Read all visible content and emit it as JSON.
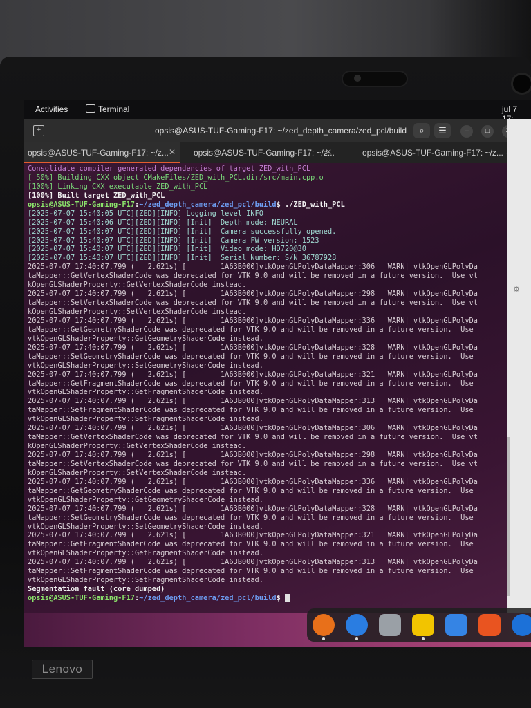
{
  "topbar": {
    "activities": "Activities",
    "app_name": "Terminal",
    "clock": "jul 7  17:"
  },
  "window": {
    "title": "opsis@ASUS-TUF-Gaming-F17: ~/zed_depth_camera/zed_pcl/build"
  },
  "tabs": [
    {
      "label": "opsis@ASUS-TUF-Gaming-F17: ~/z..."
    },
    {
      "label": "opsis@ASUS-TUF-Gaming-F17: ~/z..."
    },
    {
      "label": "opsis@ASUS-TUF-Gaming-F17: ~/z..."
    }
  ],
  "prompt": {
    "user": "opsis@ASUS-TUF-Gaming-F17",
    "path": "~/zed_depth_camera/zed_pcl/build"
  },
  "build": {
    "l0": "Consolidate compiler generated dependencies of target ZED_with_PCL",
    "l1": "[ 50%] Building CXX object CMakeFiles/ZED_with_PCL.dir/src/main.cpp.o",
    "l2": "[100%] Linking CXX executable ZED_with_PCL",
    "l3": "[100%] Built target ZED_with_PCL",
    "command": "$ ./ZED_with_PCL"
  },
  "zed_log": [
    "[2025-07-07 15:40:05 UTC][ZED][INFO] Logging level INFO",
    "[2025-07-07 15:40:06 UTC][ZED][INFO] [Init]  Depth mode: NEURAL",
    "[2025-07-07 15:40:07 UTC][ZED][INFO] [Init]  Camera successfully opened.",
    "[2025-07-07 15:40:07 UTC][ZED][INFO] [Init]  Camera FW version: 1523",
    "[2025-07-07 15:40:07 UTC][ZED][INFO] [Init]  Video mode: HD720@30",
    "[2025-07-07 15:40:07 UTC][ZED][INFO] [Init]  Serial Number: S/N 36787928"
  ],
  "vtk_warnings": [
    "2025-07-07 17:40:07.799 (   2.621s) [        1A63B000]vtkOpenGLPolyDataMapper:306   WARN| vtkOpenGLPolyDa",
    "taMapper::GetVertexShaderCode was deprecated for VTK 9.0 and will be removed in a future version.  Use vt",
    "kOpenGLShaderProperty::GetVertexShaderCode instead.",
    "2025-07-07 17:40:07.799 (   2.621s) [        1A63B000]vtkOpenGLPolyDataMapper:298   WARN| vtkOpenGLPolyDa",
    "taMapper::SetVertexShaderCode was deprecated for VTK 9.0 and will be removed in a future version.  Use vt",
    "kOpenGLShaderProperty::SetVertexShaderCode instead.",
    "2025-07-07 17:40:07.799 (   2.621s) [        1A63B000]vtkOpenGLPolyDataMapper:336   WARN| vtkOpenGLPolyDa",
    "taMapper::GetGeometryShaderCode was deprecated for VTK 9.0 and will be removed in a future version.  Use",
    "vtkOpenGLShaderProperty::GetGeometryShaderCode instead.",
    "2025-07-07 17:40:07.799 (   2.621s) [        1A63B000]vtkOpenGLPolyDataMapper:328   WARN| vtkOpenGLPolyDa",
    "taMapper::SetGeometryShaderCode was deprecated for VTK 9.0 and will be removed in a future version.  Use",
    "vtkOpenGLShaderProperty::SetGeometryShaderCode instead.",
    "2025-07-07 17:40:07.799 (   2.621s) [        1A63B000]vtkOpenGLPolyDataMapper:321   WARN| vtkOpenGLPolyDa",
    "taMapper::GetFragmentShaderCode was deprecated for VTK 9.0 and will be removed in a future version.  Use",
    "vtkOpenGLShaderProperty::GetFragmentShaderCode instead.",
    "2025-07-07 17:40:07.799 (   2.621s) [        1A63B000]vtkOpenGLPolyDataMapper:313   WARN| vtkOpenGLPolyDa",
    "taMapper::SetFragmentShaderCode was deprecated for VTK 9.0 and will be removed in a future version.  Use",
    "vtkOpenGLShaderProperty::SetFragmentShaderCode instead.",
    "2025-07-07 17:40:07.799 (   2.621s) [        1A63B000]vtkOpenGLPolyDataMapper:306   WARN| vtkOpenGLPolyDa",
    "taMapper::GetVertexShaderCode was deprecated for VTK 9.0 and will be removed in a future version.  Use vt",
    "kOpenGLShaderProperty::GetVertexShaderCode instead.",
    "2025-07-07 17:40:07.799 (   2.621s) [        1A63B000]vtkOpenGLPolyDataMapper:298   WARN| vtkOpenGLPolyDa",
    "taMapper::SetVertexShaderCode was deprecated for VTK 9.0 and will be removed in a future version.  Use vt",
    "kOpenGLShaderProperty::SetVertexShaderCode instead.",
    "2025-07-07 17:40:07.799 (   2.621s) [        1A63B000]vtkOpenGLPolyDataMapper:336   WARN| vtkOpenGLPolyDa",
    "taMapper::GetGeometryShaderCode was deprecated for VTK 9.0 and will be removed in a future version.  Use",
    "vtkOpenGLShaderProperty::GetGeometryShaderCode instead.",
    "2025-07-07 17:40:07.799 (   2.621s) [        1A63B000]vtkOpenGLPolyDataMapper:328   WARN| vtkOpenGLPolyDa",
    "taMapper::SetGeometryShaderCode was deprecated for VTK 9.0 and will be removed in a future version.  Use",
    "vtkOpenGLShaderProperty::SetGeometryShaderCode instead.",
    "2025-07-07 17:40:07.799 (   2.621s) [        1A63B000]vtkOpenGLPolyDataMapper:321   WARN| vtkOpenGLPolyDa",
    "taMapper::GetFragmentShaderCode was deprecated for VTK 9.0 and will be removed in a future version.  Use",
    "vtkOpenGLShaderProperty::GetFragmentShaderCode instead.",
    "2025-07-07 17:40:07.799 (   2.621s) [        1A63B000]vtkOpenGLPolyDataMapper:313   WARN| vtkOpenGLPolyDa",
    "taMapper::SetFragmentShaderCode was deprecated for VTK 9.0 and will be removed in a future version.  Use",
    "vtkOpenGLShaderProperty::SetFragmentShaderCode instead."
  ],
  "error_line": "Segmentation fault (core dumped)",
  "prompt_suffix": "$ ",
  "dock": [
    {
      "icon": "firefox-icon",
      "color": "#e8701a"
    },
    {
      "icon": "thunderbird-icon",
      "color": "#2a7de1"
    },
    {
      "icon": "files-icon",
      "color": "#9aa0a6"
    },
    {
      "icon": "rhythmbox-icon",
      "color": "#f2c400"
    },
    {
      "icon": "text-editor-icon",
      "color": "#3584e4"
    },
    {
      "icon": "software-center-icon",
      "color": "#e95420"
    },
    {
      "icon": "help-icon",
      "color": "#1c71d8"
    }
  ],
  "laptop": {
    "brand": "Lenovo"
  }
}
